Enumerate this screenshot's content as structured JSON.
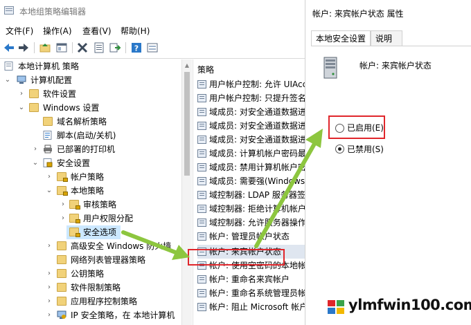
{
  "main_window": {
    "title": "本地组策略编辑器",
    "menu": [
      "文件(F)",
      "操作(A)",
      "查看(V)",
      "帮助(H)"
    ],
    "toolbar_icons": [
      "back-arrow-icon",
      "forward-arrow-icon",
      "up-folder-icon",
      "show-hide-tree-icon",
      "delete-icon",
      "properties-icon",
      "export-icon",
      "help-icon",
      "extended-view-icon"
    ]
  },
  "tree": {
    "items": [
      {
        "label": "本地计算机 策略",
        "icon": "computer-policy-icon"
      },
      {
        "label": "计算机配置",
        "icon": "computer-config-icon"
      },
      {
        "label": "软件设置",
        "icon": "folder-icon"
      },
      {
        "label": "Windows 设置",
        "icon": "folder-icon"
      },
      {
        "label": "域名解析策略",
        "icon": "folder-icon"
      },
      {
        "label": "脚本(启动/关机)",
        "icon": "script-icon"
      },
      {
        "label": "已部署的打印机",
        "icon": "printer-icon"
      },
      {
        "label": "安全设置",
        "icon": "security-icon"
      },
      {
        "label": "帐户策略",
        "icon": "lock-folder-icon"
      },
      {
        "label": "本地策略",
        "icon": "lock-folder-icon"
      },
      {
        "label": "审核策略",
        "icon": "lock-folder-icon"
      },
      {
        "label": "用户权限分配",
        "icon": "lock-folder-icon"
      },
      {
        "label": "安全选项",
        "icon": "lock-folder-icon"
      },
      {
        "label": "高级安全 Windows 防火墙",
        "icon": "folder-icon"
      },
      {
        "label": "网络列表管理器策略",
        "icon": "folder-icon"
      },
      {
        "label": "公钥策略",
        "icon": "folder-icon"
      },
      {
        "label": "软件限制策略",
        "icon": "folder-icon"
      },
      {
        "label": "应用程序控制策略",
        "icon": "folder-icon"
      },
      {
        "label": "IP 安全策略，在 本地计算机",
        "icon": "ip-security-icon"
      }
    ]
  },
  "policies": {
    "header": "策略",
    "items": [
      "用户帐户控制: 允许 UIAccess",
      "用户帐户控制: 只提升签名",
      "域成员: 对安全通道数据进",
      "域成员: 对安全通道数据进",
      "域成员: 对安全通道数据进",
      "域成员: 计算机帐户密码最",
      "域成员: 禁用计算机帐户密",
      "域成员: 需要强(Windows",
      "域控制器: LDAP 服务器签",
      "域控制器: 拒绝计算机帐户",
      "域控制器: 允许服务器操作",
      "帐户: 管理员帐户状态",
      "帐户: 来宾帐户状态",
      "帐户: 使用空密码的本地帐",
      "帐户: 重命名来宾帐户",
      "帐户: 重命名系统管理员帐",
      "帐户: 阻止 Microsoft 帐户"
    ]
  },
  "dialog": {
    "title": "帐户: 来宾帐户状态 属性",
    "tabs": [
      "本地安全设置",
      "说明"
    ],
    "policy_name": "帐户: 来宾帐户状态",
    "options": [
      {
        "label": "已启用(E)",
        "checked": false
      },
      {
        "label": "已禁用(S)",
        "checked": true
      }
    ]
  },
  "watermark": {
    "text": "ylmfwin100.com"
  },
  "colors": {
    "highlight_red": "#e0262b",
    "arrow_green": "#8dc63f",
    "selection_blue": "#cce8ff"
  }
}
